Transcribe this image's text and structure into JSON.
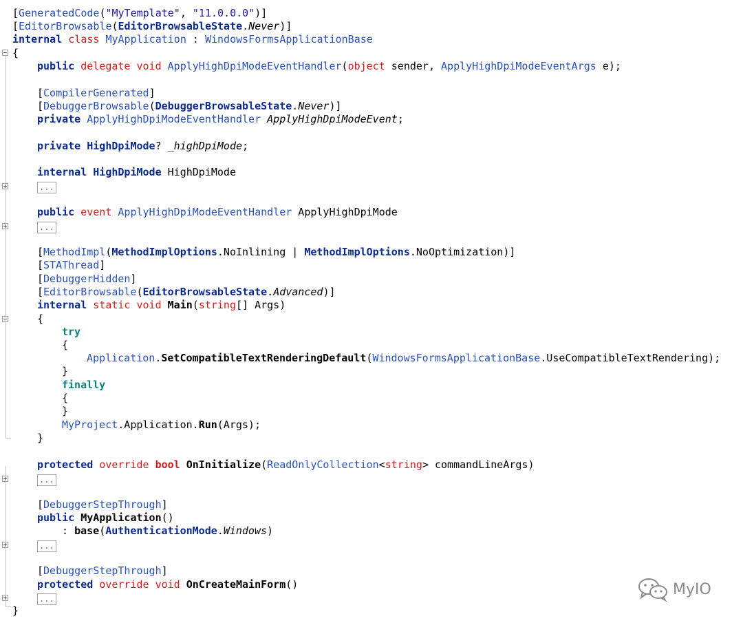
{
  "code_lines": [
    [
      "[",
      "GeneratedCode",
      "(",
      "\"MyTemplate\"",
      ", ",
      "\"11.0.0.0\"",
      ")]"
    ],
    [
      "[",
      "EditorBrowsable",
      "(",
      "EditorBrowsableState",
      ".",
      "Never",
      ")]"
    ],
    [
      "internal",
      " ",
      "class",
      " ",
      "MyApplication",
      " : ",
      "WindowsFormsApplicationBase"
    ],
    [
      "{"
    ],
    [
      "public",
      " ",
      "delegate",
      " ",
      "void",
      " ",
      "ApplyHighDpiModeEventHandler",
      "(",
      "object",
      " sender, ",
      "ApplyHighDpiModeEventArgs",
      " e);"
    ],
    [
      "[",
      "CompilerGenerated",
      "]"
    ],
    [
      "[",
      "DebuggerBrowsable",
      "(",
      "DebuggerBrowsableState",
      ".",
      "Never",
      ")]"
    ],
    [
      "private",
      " ",
      "ApplyHighDpiModeEventHandler",
      " ",
      "ApplyHighDpiModeEvent",
      ";"
    ],
    [
      "private",
      " ",
      "HighDpiMode",
      "? ",
      "_highDpiMode",
      ";"
    ],
    [
      "internal",
      " ",
      "HighDpiMode",
      " HighDpiMode"
    ],
    [
      "..."
    ],
    [
      "public",
      " ",
      "event",
      " ",
      "ApplyHighDpiModeEventHandler",
      " ApplyHighDpiMode"
    ],
    [
      "..."
    ],
    [
      "[",
      "MethodImpl",
      "(",
      "MethodImplOptions",
      ".NoInlining | ",
      "MethodImplOptions",
      ".NoOptimization)]"
    ],
    [
      "[",
      "STAThread",
      "]"
    ],
    [
      "[",
      "DebuggerHidden",
      "]"
    ],
    [
      "[",
      "EditorBrowsable",
      "(",
      "EditorBrowsableState",
      ".",
      "Advanced",
      ")]"
    ],
    [
      "internal",
      " ",
      "static",
      " ",
      "void",
      " ",
      "Main",
      "(",
      "string",
      "[] Args)"
    ],
    [
      "{"
    ],
    [
      "try"
    ],
    [
      "{"
    ],
    [
      "Application",
      ".",
      "SetCompatibleTextRenderingDefault",
      "(",
      "WindowsFormsApplicationBase",
      ".UseCompatibleTextRendering);"
    ],
    [
      "}"
    ],
    [
      "finally"
    ],
    [
      "{"
    ],
    [
      "}"
    ],
    [
      "MyProject",
      ".Application.",
      "Run",
      "(Args);"
    ],
    [
      "}"
    ],
    [
      "protected",
      " ",
      "override",
      " ",
      "bool",
      " ",
      "OnInitialize",
      "(",
      "ReadOnlyCollection",
      "<",
      "string",
      "> commandLineArgs)"
    ],
    [
      "..."
    ],
    [
      "[",
      "DebuggerStepThrough",
      "]"
    ],
    [
      "public",
      " ",
      "MyApplication",
      "()"
    ],
    [
      ": ",
      "base",
      "(",
      "AuthenticationMode",
      ".",
      "Windows",
      ")"
    ],
    [
      "..."
    ],
    [
      "[",
      "DebuggerStepThrough",
      "]"
    ],
    [
      "protected",
      " ",
      "override",
      " ",
      "void",
      " ",
      "OnCreateMainForm",
      "()"
    ],
    [
      "..."
    ],
    [
      "}"
    ]
  ],
  "watermark": {
    "text": "MyIO",
    "icon": "wechat-icon"
  }
}
